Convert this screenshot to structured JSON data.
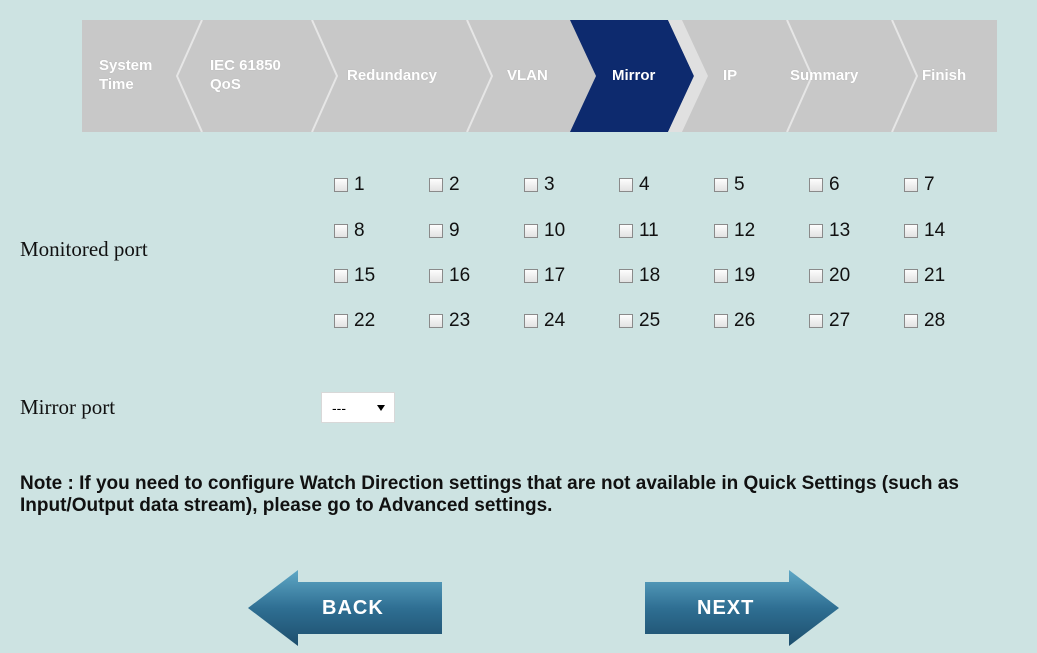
{
  "wizard": {
    "steps": [
      {
        "label": "System\nTime"
      },
      {
        "label": "IEC 61850\nQoS"
      },
      {
        "label": "Redundancy"
      },
      {
        "label": "VLAN"
      },
      {
        "label": "Mirror"
      },
      {
        "label": "IP"
      },
      {
        "label": "Summary"
      },
      {
        "label": "Finish"
      }
    ],
    "active": "Mirror",
    "active_color": "#0d2a6e",
    "inactive_color": "#c8c8c8"
  },
  "monitored": {
    "label": "Monitored port",
    "ports": [
      "1",
      "2",
      "3",
      "4",
      "5",
      "6",
      "7",
      "8",
      "9",
      "10",
      "11",
      "12",
      "13",
      "14",
      "15",
      "16",
      "17",
      "18",
      "19",
      "20",
      "21",
      "22",
      "23",
      "24",
      "25",
      "26",
      "27",
      "28"
    ],
    "checked": []
  },
  "mirror": {
    "label": "Mirror port",
    "selected": "---"
  },
  "note": "Note : If you need to configure Watch Direction settings that are not available in Quick Settings (such as Input/Output data stream), please go to Advanced settings.",
  "buttons": {
    "back": "BACK",
    "next": "NEXT"
  }
}
